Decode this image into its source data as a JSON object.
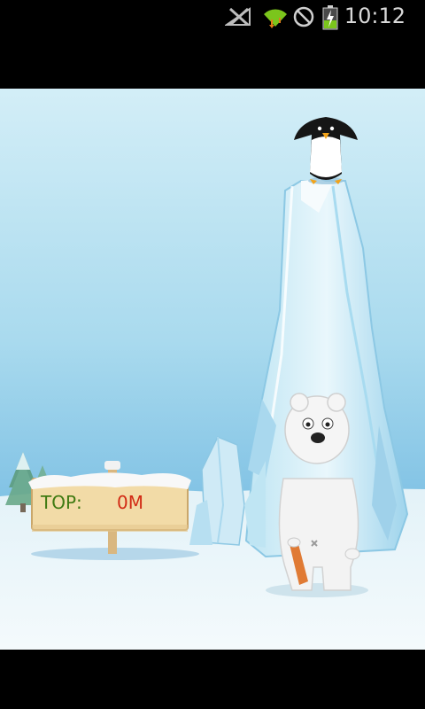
{
  "status_bar": {
    "time": "10:12",
    "icons": [
      "signal-muted-icon",
      "wifi-icon",
      "do-not-disturb-icon",
      "battery-charging-icon"
    ]
  },
  "game": {
    "sign": {
      "label": "TOP:",
      "value": "0M"
    },
    "characters": [
      "penguin",
      "polar-bear"
    ],
    "colors": {
      "sky_top": "#cdebf5",
      "sky_mid": "#86c6e6",
      "snow": "#eef7fb",
      "sign_wood": "#f0d9a4",
      "label_green": "#3f7a12",
      "value_red": "#d22a14"
    }
  }
}
